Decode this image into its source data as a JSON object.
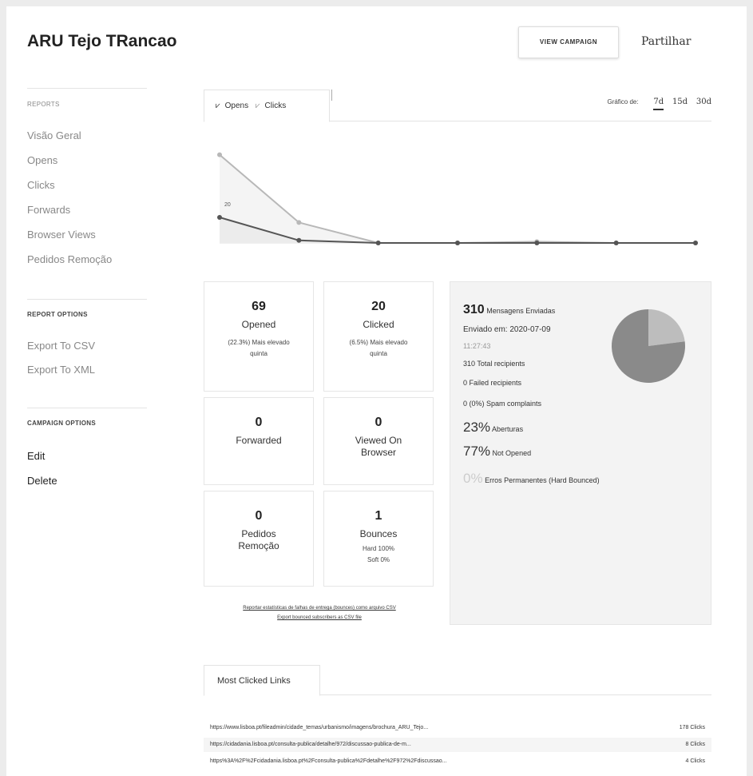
{
  "header": {
    "title": "ARU Tejo TRancao",
    "view_campaign": "VIEW CAMPAIGN",
    "share": "Partilhar"
  },
  "sidebar": {
    "reports_heading": "REPORTS",
    "reports": [
      "Visão Geral",
      "Opens",
      "Clicks",
      "Forwards",
      "Browser Views",
      "Pedidos Remoção"
    ],
    "report_options_heading": "REPORT OPTIONS",
    "report_options": [
      "Export To CSV",
      "Export To XML"
    ],
    "campaign_options_heading": "CAMPAIGN OPTIONS",
    "campaign_options": [
      "Edit",
      "Delete"
    ]
  },
  "tabs": {
    "opens": "Opens",
    "clicks": "Clicks",
    "range_label": "Gráfico de:",
    "ranges": [
      "7d",
      "15d",
      "30d"
    ],
    "active_range": "7d"
  },
  "chart_data": {
    "type": "line",
    "x": [
      0,
      1,
      2,
      3,
      4,
      5,
      6
    ],
    "series": [
      {
        "values": [
          69,
          16,
          0,
          0,
          1,
          0,
          0
        ],
        "color": "#b8b8b8"
      },
      {
        "values": [
          20,
          2,
          0,
          0,
          0,
          0,
          0
        ],
        "color": "#555555"
      }
    ],
    "point_label": "20",
    "ylim": [
      0,
      75
    ],
    "grid": false
  },
  "stats": [
    {
      "num": "69",
      "label": "Opened",
      "sub": "(22.3%) Mais elevado quinta"
    },
    {
      "num": "20",
      "label": "Clicked",
      "sub": "(6.5%) Mais elevado quinta"
    },
    {
      "num": "0",
      "label": "Forwarded",
      "sub": ""
    },
    {
      "num": "0",
      "label": "Viewed On Browser",
      "sub": ""
    },
    {
      "num": "0",
      "label": "Pedidos Remoção",
      "sub": ""
    },
    {
      "num": "1",
      "label": "Bounces",
      "sub": "Hard 100%\nSoft 0%"
    }
  ],
  "summary": {
    "sent_count": "310",
    "sent_label": "Mensagens Enviadas",
    "sent_date": "Enviado em: 2020-07-09",
    "sent_time": "11:27:43",
    "total_recipients": "310 Total recipients",
    "failed_recipients": "0 Failed recipients",
    "spam_complaints": "0 (0%) Spam complaints",
    "opens_pct": "23%",
    "opens_label": "Aberturas",
    "not_opened_pct": "77%",
    "not_opened_label": "Not Opened",
    "bounced_pct": "0%",
    "bounced_label": "Erros Permanentes (Hard Bounced)",
    "pie": {
      "opened": 23,
      "not_opened": 77,
      "opened_color": "#bdbdbd",
      "not_opened_color": "#8a8a8a"
    }
  },
  "export_links": {
    "line1": "Reportar estatísticas de falhas de entrega (bounces) como arquivo CSV",
    "line2": "Export bounced subscribers as CSV file"
  },
  "most_clicked": {
    "tab": "Most Clicked Links",
    "rows": [
      {
        "url": "https://www.lisboa.pt/fileadmin/cidade_temas/urbanismo/imagens/brochura_ARU_Tejo...",
        "count": "178 Clicks"
      },
      {
        "url": "https://cidadania.lisboa.pt/consulta-publica/detalhe/972/discussao-publica-de-m...",
        "count": "8 Clicks"
      },
      {
        "url": "https%3A%2F%2Fcidadania.lisboa.pt%2Fconsulta-publica%2Fdetalhe%2F972%2Fdiscussao...",
        "count": "4 Clicks"
      }
    ]
  }
}
